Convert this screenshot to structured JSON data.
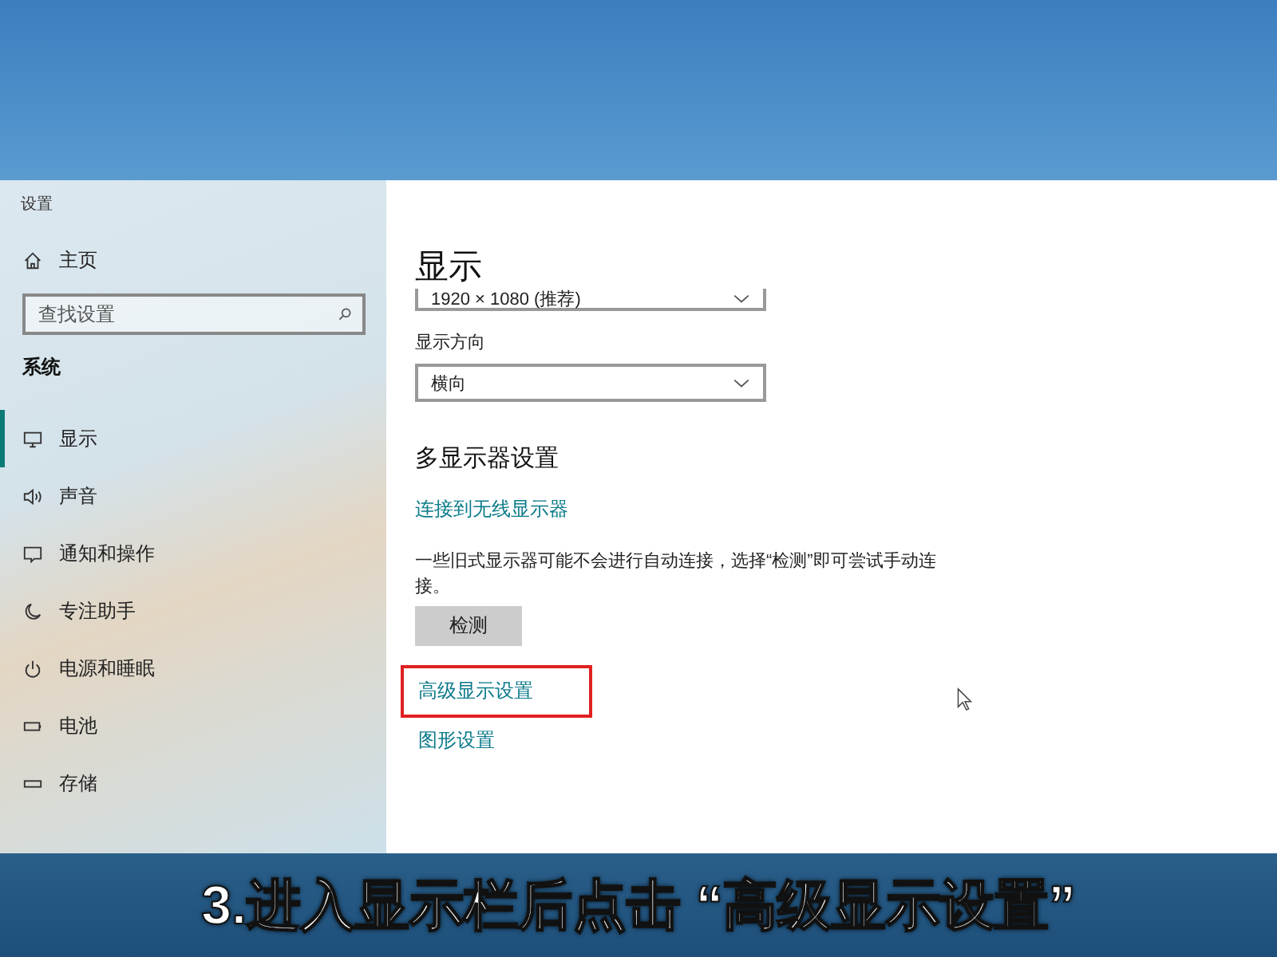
{
  "window": {
    "title": "设置"
  },
  "sidebar": {
    "home": "主页",
    "search": {
      "placeholder": "查找设置"
    },
    "section": "系统",
    "items": [
      {
        "label": "显示",
        "kind": "monitor",
        "selected": true
      },
      {
        "label": "声音",
        "kind": "speaker",
        "selected": false
      },
      {
        "label": "通知和操作",
        "kind": "message",
        "selected": false
      },
      {
        "label": "专注助手",
        "kind": "moon",
        "selected": false
      },
      {
        "label": "电源和睡眠",
        "kind": "power",
        "selected": false
      },
      {
        "label": "电池",
        "kind": "battery",
        "selected": false
      },
      {
        "label": "存储",
        "kind": "drive",
        "selected": false
      }
    ]
  },
  "content": {
    "title": "显示",
    "resolution": {
      "value": "1920 × 1080 (推荐)"
    },
    "orientation": {
      "label": "显示方向",
      "value": "横向"
    },
    "multi_display": {
      "heading": "多显示器设置",
      "connect_link": "连接到无线显示器",
      "description": "一些旧式显示器可能不会进行自动连接，选择“检测”即可尝试手动连接。",
      "detect_button": "检测"
    },
    "links": [
      {
        "label": "高级显示设置",
        "highlighted": true
      },
      {
        "label": "图形设置",
        "highlighted": false
      }
    ]
  },
  "caption": "3.进入显示栏后点击 “高级显示设置”"
}
